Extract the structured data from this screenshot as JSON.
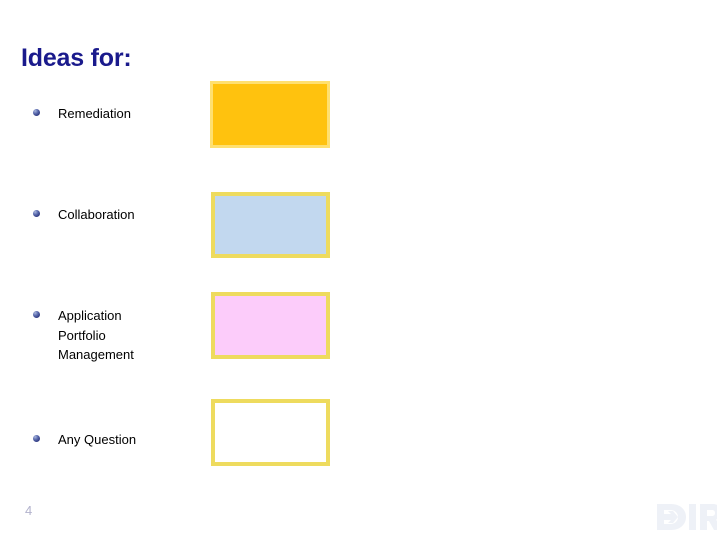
{
  "slide": {
    "title": "Ideas for:",
    "title_color": "#1a1a8c",
    "background_color": "#ffffff",
    "page_number": "4"
  },
  "bullets": [
    {
      "label": "Remediation",
      "bullet_icon": "blue-sphere-bullet-icon"
    },
    {
      "label": "Collaboration",
      "bullet_icon": "blue-sphere-bullet-icon"
    },
    {
      "label": "Application\nPortfolio\nManagement",
      "bullet_icon": "blue-sphere-bullet-icon"
    },
    {
      "label": "Any Question",
      "bullet_icon": "blue-sphere-bullet-icon"
    }
  ],
  "swatches": [
    {
      "name": "remediation-swatch",
      "fill": "#FFC20E",
      "border": "#FFE070"
    },
    {
      "name": "collaboration-swatch",
      "fill": "#C2D8EF",
      "border": "#EEDB5E"
    },
    {
      "name": "application-portfolio-management-swatch",
      "fill": "#FCCCFA",
      "border": "#EEDB5E"
    },
    {
      "name": "any-question-swatch",
      "fill": "#FFFFFF",
      "border": "#EEDB5E"
    }
  ],
  "footer": {
    "logo_text": "DIR",
    "logo_color": "#eef1f7"
  }
}
